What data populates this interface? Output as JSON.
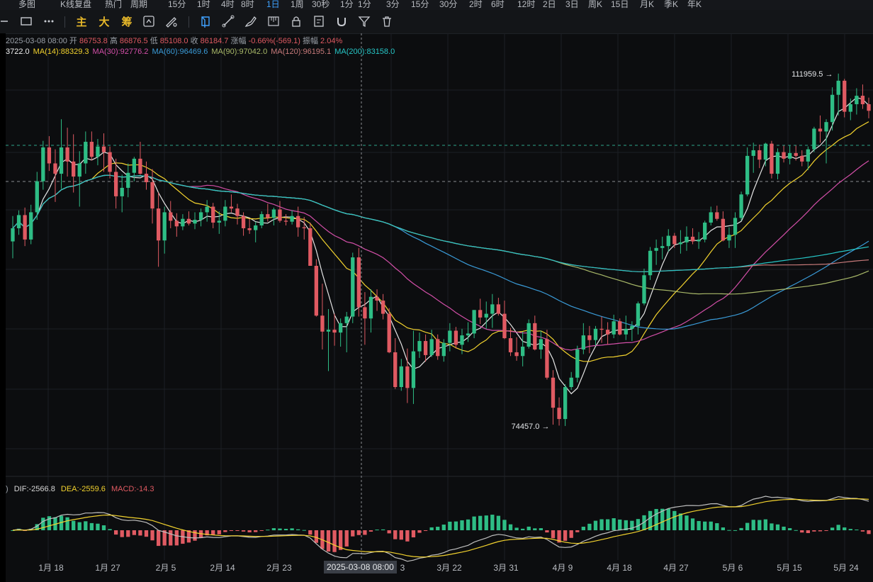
{
  "timeframes": [
    "多图",
    "K线复盘",
    "热门",
    "周期",
    "15分",
    "1时",
    "4时",
    "8时",
    "1日",
    "1周",
    "30秒",
    "1分",
    "1分",
    "3分",
    "15分",
    "30分",
    "2时",
    "6时",
    "12时",
    "2日",
    "3日",
    "周K",
    "15日",
    "月K",
    "季K",
    "年K"
  ],
  "timeframe_active_index": 8,
  "toolbar": {
    "indicators": [
      "主",
      "大",
      "筹"
    ],
    "icons": [
      "horizontal-line-icon",
      "rectangle-icon",
      "more-icon",
      "fold-icon",
      "compare-icon",
      "draw-line-icon",
      "ruler-icon",
      "brush-icon",
      "candle-settings-icon",
      "lock-icon",
      "notes-icon",
      "magnet-icon",
      "filter-icon",
      "trash-icon"
    ]
  },
  "ohlc": {
    "date": "2025-03-08 08:00",
    "open_label": "开",
    "open": "86753.8",
    "high_label": "高",
    "high": "86876.5",
    "low_label": "低",
    "low": "85108.0",
    "close_label": "收",
    "close": "86184.7",
    "change_label": "涨幅",
    "change": "-0.66%(-569.1)",
    "amp_label": "振幅",
    "amp": "2.04%"
  },
  "ma_legend": [
    {
      "text": "3722.0",
      "color": "#f0f0f0"
    },
    {
      "text": "MA(14):88329.3",
      "color": "#f2d22e"
    },
    {
      "text": "MA(30):92776.2",
      "color": "#d34fa8"
    },
    {
      "text": "MA(60):96469.6",
      "color": "#3a9bd8"
    },
    {
      "text": "MA(90):97042.0",
      "color": "#a9b969"
    },
    {
      "text": "MA(120):96195.1",
      "color": "#c77a7a"
    },
    {
      "text": "MA(200):83158.0",
      "color": "#26c6c6"
    }
  ],
  "macd_legend": {
    "paren": ")",
    "dif": "DIF:-2566.8",
    "dea": "DEA:-2559.6",
    "macd": "MACD:-14.3",
    "dif_color": "#d8d8d8",
    "dea_color": "#f2d22e",
    "macd_color": "#e05a62"
  },
  "cursor_date": "2025-03-08 08:00",
  "colors": {
    "up": "#2ebd85",
    "down": "#e05a62",
    "bg": "#0c0d0f",
    "grid": "#1d2024"
  },
  "chart_data": {
    "type": "candlestick",
    "title": "",
    "annotations": {
      "high": "111959.5",
      "low": "74457.0"
    },
    "x_tick_labels": [
      "1月 18",
      "1月 27",
      "2月 5",
      "2月 14",
      "2月 23",
      "3",
      "3月 22",
      "3月 31",
      "4月 9",
      "4月 18",
      "4月 27",
      "5月 6",
      "5月 15",
      "5月 24"
    ],
    "ylim": [
      70000,
      113000
    ],
    "candles": [
      [
        94100,
        96800,
        92300,
        95500
      ],
      [
        95500,
        97400,
        94800,
        96900
      ],
      [
        96900,
        97700,
        93600,
        94300
      ],
      [
        94300,
        98000,
        93800,
        97200
      ],
      [
        97200,
        101500,
        96400,
        100500
      ],
      [
        100500,
        104800,
        99600,
        104100
      ],
      [
        104100,
        105300,
        101600,
        102400
      ],
      [
        102400,
        103900,
        98300,
        101300
      ],
      [
        101300,
        107100,
        99700,
        104100
      ],
      [
        104100,
        106200,
        101000,
        102600
      ],
      [
        102600,
        105500,
        99300,
        101000
      ],
      [
        101000,
        103700,
        97800,
        102400
      ],
      [
        102400,
        105800,
        101300,
        104700
      ],
      [
        104700,
        105800,
        102700,
        103100
      ],
      [
        103100,
        105000,
        102200,
        104200
      ],
      [
        104200,
        105600,
        101500,
        103600
      ],
      [
        103600,
        104200,
        100800,
        101500
      ],
      [
        101500,
        102900,
        97600,
        98900
      ],
      [
        98900,
        101200,
        97200,
        99800
      ],
      [
        99800,
        102400,
        98800,
        101400
      ],
      [
        101400,
        103100,
        100500,
        102900
      ],
      [
        102900,
        104700,
        101200,
        101300
      ],
      [
        101300,
        102600,
        99600,
        100400
      ],
      [
        100400,
        101800,
        96000,
        97600
      ],
      [
        97600,
        99300,
        91400,
        94200
      ],
      [
        94200,
        97800,
        92800,
        97200
      ],
      [
        97200,
        98400,
        95500,
        96300
      ],
      [
        96300,
        97100,
        94600,
        95700
      ],
      [
        95700,
        97000,
        95300,
        96500
      ],
      [
        96500,
        97300,
        95800,
        96000
      ],
      [
        96000,
        97200,
        95400,
        96400
      ],
      [
        96400,
        97600,
        95700,
        97200
      ],
      [
        97200,
        98500,
        96200,
        97800
      ],
      [
        97800,
        98200,
        95500,
        96100
      ],
      [
        96100,
        97300,
        94900,
        96300
      ],
      [
        96300,
        98500,
        95700,
        97800
      ],
      [
        97800,
        99100,
        97200,
        97600
      ],
      [
        97600,
        98100,
        95900,
        96800
      ],
      [
        96800,
        97200,
        94700,
        95500
      ],
      [
        95500,
        96500,
        94900,
        95300
      ],
      [
        95300,
        96200,
        94000,
        95800
      ],
      [
        95800,
        97300,
        95500,
        97000
      ],
      [
        97000,
        98100,
        96200,
        96600
      ],
      [
        96600,
        97700,
        95800,
        97500
      ],
      [
        97500,
        98400,
        96100,
        96300
      ],
      [
        96300,
        97000,
        95800,
        96200
      ],
      [
        96200,
        97400,
        95900,
        96800
      ],
      [
        96800,
        97800,
        94600,
        95600
      ],
      [
        95600,
        96700,
        94300,
        95500
      ],
      [
        95500,
        96100,
        91500,
        91500
      ],
      [
        91500,
        92200,
        86100,
        86200
      ],
      [
        86200,
        89600,
        82600,
        84500
      ],
      [
        84500,
        86900,
        80300,
        84700
      ],
      [
        84700,
        86400,
        83000,
        84400
      ],
      [
        84400,
        85900,
        82900,
        85400
      ],
      [
        85400,
        86600,
        82300,
        86100
      ],
      [
        86100,
        92900,
        85400,
        92400
      ],
      [
        92400,
        93400,
        86100,
        87100
      ],
      [
        87100,
        88700,
        83100,
        85900
      ],
      [
        85900,
        89000,
        84400,
        88200
      ],
      [
        88200,
        89000,
        86700,
        87800
      ],
      [
        87800,
        88500,
        85800,
        86400
      ],
      [
        86400,
        87000,
        82200,
        82300
      ],
      [
        82300,
        83800,
        78400,
        78600
      ],
      [
        78600,
        81600,
        78200,
        80800
      ],
      [
        80800,
        82700,
        76900,
        78500
      ],
      [
        78500,
        84600,
        76800,
        82400
      ],
      [
        82400,
        84400,
        81700,
        83500
      ],
      [
        83500,
        84200,
        81300,
        82000
      ],
      [
        82000,
        84700,
        81800,
        83700
      ],
      [
        83700,
        84200,
        81500,
        81900
      ],
      [
        81900,
        83700,
        81300,
        83300
      ],
      [
        83300,
        85400,
        82400,
        84600
      ],
      [
        84600,
        85000,
        82700,
        83100
      ],
      [
        83100,
        84800,
        82100,
        84100
      ],
      [
        84100,
        85500,
        83400,
        84300
      ],
      [
        84300,
        86800,
        83800,
        86800
      ],
      [
        86800,
        88000,
        85300,
        86000
      ],
      [
        86000,
        87700,
        84800,
        86400
      ],
      [
        86400,
        88500,
        84900,
        87400
      ],
      [
        87400,
        88100,
        86200,
        86400
      ],
      [
        86400,
        87800,
        83700,
        83800
      ],
      [
        83800,
        84900,
        81900,
        82300
      ],
      [
        82300,
        83900,
        81400,
        81900
      ],
      [
        81900,
        84500,
        80800,
        82900
      ],
      [
        82900,
        85800,
        82700,
        85400
      ],
      [
        85400,
        86200,
        82500,
        82600
      ],
      [
        82600,
        84600,
        81600,
        83700
      ],
      [
        83700,
        84700,
        79400,
        79600
      ],
      [
        79600,
        80400,
        74600,
        76400
      ],
      [
        76400,
        77500,
        74500,
        75200
      ],
      [
        75200,
        78900,
        74457,
        78600
      ],
      [
        78600,
        80200,
        78300,
        79600
      ],
      [
        79600,
        83000,
        79100,
        82600
      ],
      [
        82600,
        85400,
        82100,
        84100
      ],
      [
        84100,
        85100,
        82200,
        83600
      ],
      [
        83600,
        85100,
        83000,
        84800
      ],
      [
        84800,
        86100,
        83300,
        84700
      ],
      [
        84700,
        85500,
        83100,
        84200
      ],
      [
        84200,
        86300,
        83800,
        85600
      ],
      [
        85600,
        85900,
        84100,
        84200
      ],
      [
        84200,
        86200,
        83600,
        84800
      ],
      [
        84800,
        85600,
        83500,
        85100
      ],
      [
        85100,
        87700,
        84200,
        87500
      ],
      [
        87500,
        91200,
        87300,
        90500
      ],
      [
        90500,
        93500,
        90000,
        93100
      ],
      [
        93100,
        94300,
        91600,
        93400
      ],
      [
        93400,
        94600,
        92200,
        93600
      ],
      [
        93600,
        95400,
        93000,
        94700
      ],
      [
        94700,
        95000,
        93400,
        93800
      ],
      [
        93800,
        95300,
        92800,
        94000
      ],
      [
        94000,
        95700,
        93100,
        94600
      ],
      [
        94600,
        95500,
        93800,
        94100
      ],
      [
        94100,
        95100,
        93300,
        94300
      ],
      [
        94300,
        96300,
        94000,
        96100
      ],
      [
        96100,
        97800,
        95800,
        97200
      ],
      [
        97200,
        97900,
        96300,
        96500
      ],
      [
        96500,
        97300,
        94100,
        94200
      ],
      [
        94200,
        95600,
        93400,
        94800
      ],
      [
        94800,
        97200,
        93400,
        96600
      ],
      [
        96600,
        99400,
        96300,
        99100
      ],
      [
        99100,
        104100,
        98900,
        103200
      ],
      [
        103200,
        104600,
        101400,
        103800
      ],
      [
        103800,
        104400,
        101900,
        102800
      ],
      [
        102800,
        104600,
        102100,
        104500
      ],
      [
        104500,
        104800,
        100800,
        101300
      ],
      [
        101300,
        104000,
        100700,
        103600
      ],
      [
        103600,
        104300,
        102500,
        102900
      ],
      [
        102900,
        104300,
        102300,
        103500
      ],
      [
        103500,
        104300,
        102700,
        103200
      ],
      [
        103200,
        103800,
        102100,
        102600
      ],
      [
        102600,
        104200,
        101700,
        103900
      ],
      [
        103900,
        106300,
        103600,
        106100
      ],
      [
        106100,
        107500,
        104600,
        105800
      ],
      [
        105800,
        107100,
        102400,
        106800
      ],
      [
        106800,
        110500,
        105900,
        109700
      ],
      [
        109700,
        111959,
        107500,
        111200
      ],
      [
        111200,
        111400,
        107300,
        107900
      ],
      [
        107900,
        109300,
        107000,
        108700
      ],
      [
        108700,
        110400,
        107600,
        109600
      ],
      [
        109600,
        110800,
        108200,
        108700
      ],
      [
        108700,
        109400,
        107200,
        108000
      ]
    ],
    "moving_averages": [
      {
        "name": "MA(14)",
        "color": "#f2d22e",
        "period": 14
      },
      {
        "name": "MA(30)",
        "color": "#d34fa8",
        "period": 30
      },
      {
        "name": "MA(60)",
        "color": "#3a9bd8",
        "period": 60
      },
      {
        "name": "MA(90)",
        "color": "#a9b969",
        "period": 90
      },
      {
        "name": "MA(120)",
        "color": "#c77a7a",
        "period": 120
      },
      {
        "name": "MA(200)",
        "color": "#26c6c6",
        "period": 200
      }
    ],
    "macd": {
      "dif": -2566.8,
      "dea": -2559.6,
      "macd": -14.3
    }
  }
}
